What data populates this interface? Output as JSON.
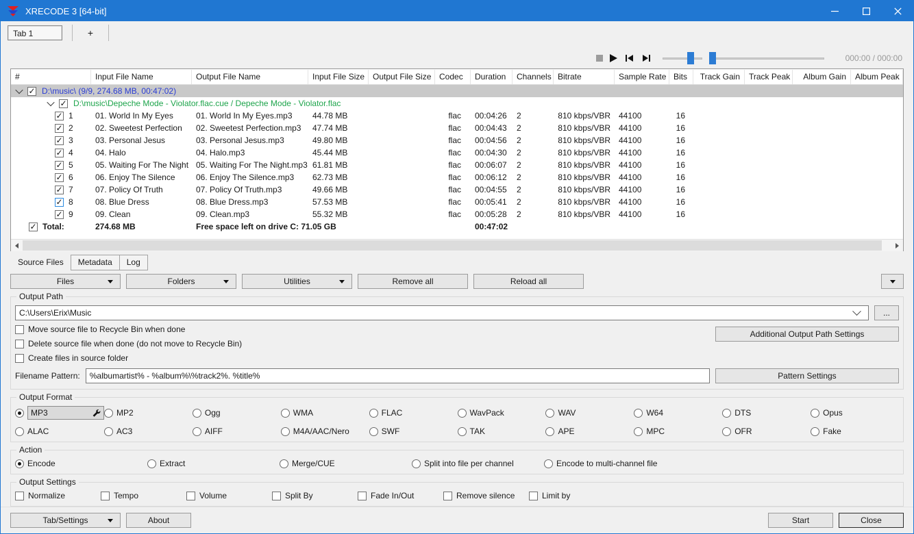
{
  "window": {
    "title": "XRECODE 3 [64-bit]"
  },
  "tabstrip": {
    "tab1": "Tab 1",
    "add_tab": "+"
  },
  "player": {
    "time": "000:00 / 000:00"
  },
  "table": {
    "columns": [
      "#",
      "Input File Name",
      "Output File Name",
      "Input File Size",
      "Output File Size",
      "Codec",
      "Duration",
      "Channels",
      "Bitrate",
      "Sample Rate",
      "Bits",
      "Track Gain",
      "Track Peak",
      "Album Gain",
      "Album Peak"
    ],
    "group_row": "D:\\music\\ (9/9, 274.68 MB, 00:47:02)",
    "cue_row": "D:\\music\\Depeche Mode - Violator.flac.cue / Depeche Mode - Violator.flac",
    "rows": [
      {
        "num": "1",
        "input": "01. World In My Eyes",
        "output": "01. World In My Eyes.mp3",
        "size": "44.78 MB",
        "codec": "flac",
        "duration": "00:04:26",
        "channels": "2",
        "bitrate": "810 kbps/VBR",
        "samplerate": "44100",
        "bits": "16",
        "checked": true,
        "focused": false
      },
      {
        "num": "2",
        "input": "02. Sweetest Perfection",
        "output": "02. Sweetest Perfection.mp3",
        "size": "47.74 MB",
        "codec": "flac",
        "duration": "00:04:43",
        "channels": "2",
        "bitrate": "810 kbps/VBR",
        "samplerate": "44100",
        "bits": "16",
        "checked": true,
        "focused": false
      },
      {
        "num": "3",
        "input": "03. Personal Jesus",
        "output": "03. Personal Jesus.mp3",
        "size": "49.80 MB",
        "codec": "flac",
        "duration": "00:04:56",
        "channels": "2",
        "bitrate": "810 kbps/VBR",
        "samplerate": "44100",
        "bits": "16",
        "checked": true,
        "focused": false
      },
      {
        "num": "4",
        "input": "04. Halo",
        "output": "04. Halo.mp3",
        "size": "45.44 MB",
        "codec": "flac",
        "duration": "00:04:30",
        "channels": "2",
        "bitrate": "810 kbps/VBR",
        "samplerate": "44100",
        "bits": "16",
        "checked": true,
        "focused": false
      },
      {
        "num": "5",
        "input": "05. Waiting For The Night",
        "output": "05. Waiting For The Night.mp3",
        "size": "61.81 MB",
        "codec": "flac",
        "duration": "00:06:07",
        "channels": "2",
        "bitrate": "810 kbps/VBR",
        "samplerate": "44100",
        "bits": "16",
        "checked": true,
        "focused": false
      },
      {
        "num": "6",
        "input": "06. Enjoy The Silence",
        "output": "06. Enjoy The Silence.mp3",
        "size": "62.73 MB",
        "codec": "flac",
        "duration": "00:06:12",
        "channels": "2",
        "bitrate": "810 kbps/VBR",
        "samplerate": "44100",
        "bits": "16",
        "checked": true,
        "focused": false
      },
      {
        "num": "7",
        "input": "07. Policy Of Truth",
        "output": "07. Policy Of Truth.mp3",
        "size": "49.66 MB",
        "codec": "flac",
        "duration": "00:04:55",
        "channels": "2",
        "bitrate": "810 kbps/VBR",
        "samplerate": "44100",
        "bits": "16",
        "checked": true,
        "focused": false
      },
      {
        "num": "8",
        "input": "08. Blue Dress",
        "output": "08. Blue Dress.mp3",
        "size": "57.53 MB",
        "codec": "flac",
        "duration": "00:05:41",
        "channels": "2",
        "bitrate": "810 kbps/VBR",
        "samplerate": "44100",
        "bits": "16",
        "checked": true,
        "focused": true
      },
      {
        "num": "9",
        "input": "09. Clean",
        "output": "09. Clean.mp3",
        "size": "55.32 MB",
        "codec": "flac",
        "duration": "00:05:28",
        "channels": "2",
        "bitrate": "810 kbps/VBR",
        "samplerate": "44100",
        "bits": "16",
        "checked": true,
        "focused": false
      }
    ],
    "total": {
      "label": "Total:",
      "size": "274.68 MB",
      "free_space": "Free space left on drive C: 71.05 GB",
      "duration": "00:47:02"
    }
  },
  "subtabs": [
    "Source Files",
    "Metadata",
    "Log"
  ],
  "active_subtab": "Source Files",
  "toolbar": {
    "files": "Files",
    "folders": "Folders",
    "utilities": "Utilities",
    "remove_all": "Remove all",
    "reload_all": "Reload all"
  },
  "output_path": {
    "group_label": "Output Path",
    "path_value": "C:\\Users\\Erix\\Music",
    "browse_label": "...",
    "checkboxes": [
      {
        "label": "Move source file to Recycle Bin when done",
        "checked": false
      },
      {
        "label": "Delete source file when done (do not move to Recycle Bin)",
        "checked": false
      },
      {
        "label": "Create files in source folder",
        "checked": false
      }
    ],
    "additional_button": "Additional Output Path Settings",
    "filename_pattern_label": "Filename Pattern:",
    "filename_pattern_value": "%albumartist% - %album%\\%track2%. %title%",
    "pattern_button": "Pattern Settings"
  },
  "output_format": {
    "group_label": "Output Format",
    "selected": "MP3",
    "row1": [
      "MP3",
      "MP2",
      "Ogg",
      "WMA",
      "FLAC",
      "WavPack",
      "WAV",
      "W64",
      "DTS",
      "Opus"
    ],
    "row2": [
      "ALAC",
      "AC3",
      "AIFF",
      "M4A/AAC/Nero",
      "SWF",
      "TAK",
      "APE",
      "MPC",
      "OFR",
      "Fake"
    ]
  },
  "action": {
    "group_label": "Action",
    "selected": "Encode",
    "options": [
      "Encode",
      "Extract",
      "Merge/CUE",
      "Split into file per channel",
      "Encode to multi-channel file"
    ]
  },
  "output_settings": {
    "group_label": "Output Settings",
    "options": [
      "Normalize",
      "Tempo",
      "Volume",
      "Split By",
      "Fade In/Out",
      "Remove silence",
      "Limit by"
    ]
  },
  "bottom": {
    "tab_settings": "Tab/Settings",
    "about": "About",
    "start": "Start",
    "close": "Close"
  },
  "colors": {
    "titlebar": "#2077d2",
    "accent": "#2c7cd4",
    "selected_row_bg": "#c9c9c9",
    "group_text": "#2a3cd4",
    "cue_text": "#1da44b"
  }
}
